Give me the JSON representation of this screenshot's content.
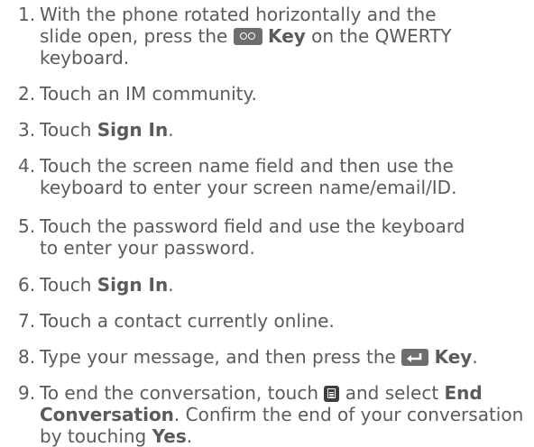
{
  "steps": [
    {
      "num": "1.",
      "lines": [
        {
          "pre": "With the phone rotated horizontally and the"
        },
        {
          "pre": "slide open, press the ",
          "icon": "voice-key-icon",
          "bold": "Key",
          "post": " on the QWERTY"
        },
        {
          "pre": "keyboard."
        }
      ]
    },
    {
      "num": "2.",
      "lines": [
        {
          "pre": "Touch an IM community."
        }
      ]
    },
    {
      "num": "3.",
      "lines": [
        {
          "pre": "Touch ",
          "bold": "Sign In",
          "post": "."
        }
      ]
    },
    {
      "num": "4.",
      "lines": [
        {
          "pre": "Touch the screen name field and then use the"
        },
        {
          "pre": "keyboard to enter your screen name/email/ID."
        }
      ]
    },
    {
      "num": "5.",
      "lines": [
        {
          "pre": "Touch the password field and use the keyboard"
        },
        {
          "pre": "to enter your password."
        }
      ]
    },
    {
      "num": "6.",
      "lines": [
        {
          "pre": "Touch ",
          "bold": "Sign In",
          "post": "."
        }
      ]
    },
    {
      "num": "7.",
      "lines": [
        {
          "pre": "Touch a contact currently online."
        }
      ]
    },
    {
      "num": "8.",
      "lines": [
        {
          "pre": "Type your message, and then press the ",
          "icon": "enter-key-icon",
          "bold": "Key",
          "post": "."
        }
      ]
    },
    {
      "num": "9.",
      "lines": [
        {
          "pre": "To end the conversation, touch ",
          "icon": "menu-key-icon",
          "mid": " and select ",
          "bold": "End"
        },
        {
          "bold": "Conversation",
          "post": ". Confirm the end of your conversation"
        },
        {
          "pre": "by touching ",
          "bold": "Yes",
          "post": "."
        }
      ]
    }
  ],
  "colors": {
    "text": "#5b5b5b",
    "icon_bg": "#6e6e6e",
    "menu_icon_bg": "#3f3f3f"
  }
}
